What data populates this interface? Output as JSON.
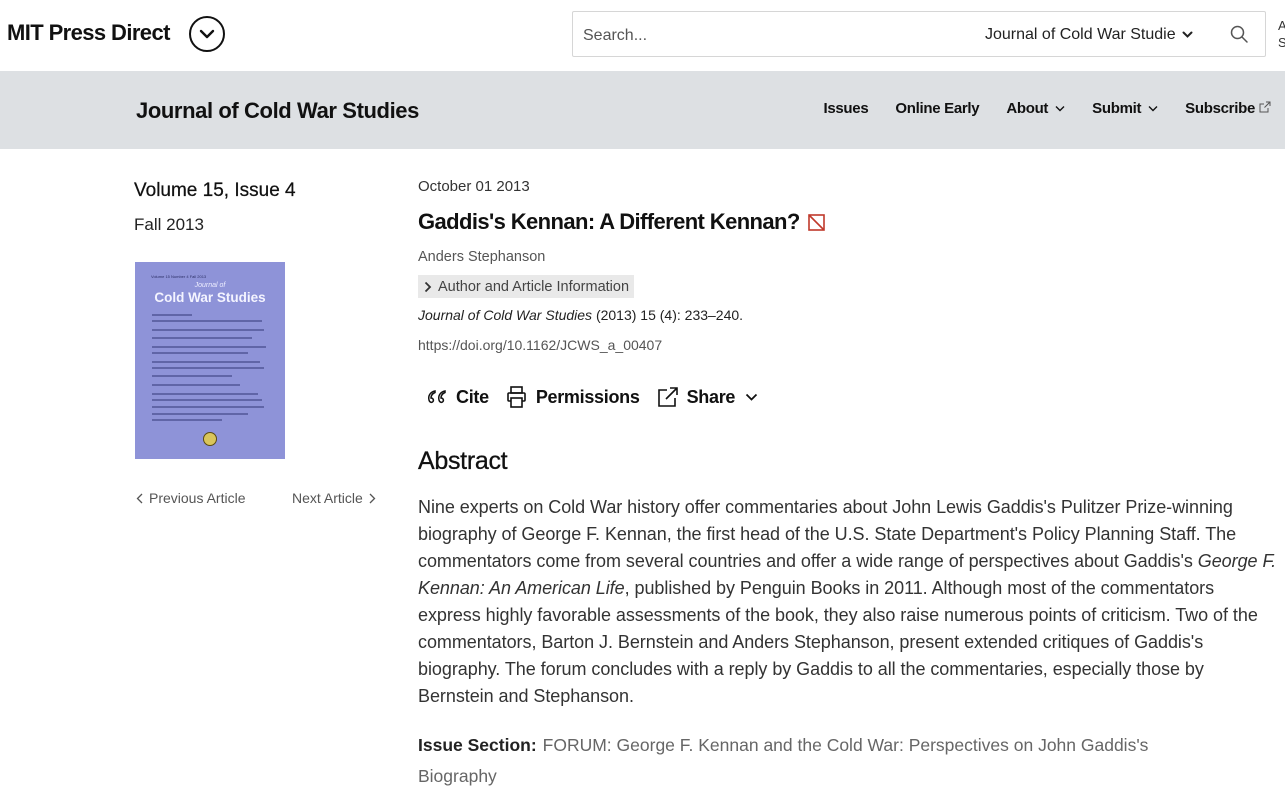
{
  "topbar": {
    "brand": "MIT Press Direct",
    "brand_toggle_icon": "chevron-down-icon",
    "search": {
      "placeholder": "Search...",
      "value": ""
    },
    "scope": "Journal of Cold War Studies",
    "search_icon": "search-icon",
    "edge_text": "A S"
  },
  "journal": {
    "title": "Journal of Cold War Studies",
    "nav": [
      {
        "label": "Issues"
      },
      {
        "label": "Online Early"
      },
      {
        "label": "About",
        "icon": "chevron-down-icon"
      },
      {
        "label": "Submit",
        "icon": "chevron-down-icon"
      },
      {
        "label": "Subscribe",
        "icon": "external-link-icon"
      }
    ]
  },
  "issue": {
    "volume_issue": "Volume 15, Issue 4",
    "season": "Fall 2013",
    "cover": {
      "small_header": "Volume 15  Number 4                                    Fall 2013",
      "journal_of": "Journal of",
      "title": "Cold War Studies"
    },
    "prev_label": "Previous Article",
    "next_label": "Next Article"
  },
  "article": {
    "date": "October 01 2013",
    "title": "Gaddis's Kennan: A Different Kennan?",
    "access_icon": "no-access-icon",
    "author": "Anders Stephanson",
    "info_toggle": "Author and Article Information",
    "citation_journal": "Journal of Cold War Studies",
    "citation_rest": " (2013) 15 (4): 233–240.",
    "doi": "https://doi.org/10.1162/JCWS_a_00407",
    "tools": {
      "cite": "Cite",
      "permissions": "Permissions",
      "share": "Share"
    },
    "abstract_heading": "Abstract",
    "abstract_part1": "Nine experts on Cold War history offer commentaries about John Lewis Gaddis's Pulitzer Prize-winning biography of George F. Kennan, the first head of the U.S. State Department's Policy Planning Staff. The commentators come from several countries and offer a wide range of perspectives about Gaddis's ",
    "abstract_book": "George F. Kennan: An American Life",
    "abstract_part2": ", published by Penguin Books in 2011. Although most of the commentators express highly favorable assessments of the book, they also raise numerous points of criticism. Two of the commentators, Barton J. Bernstein and Anders Stephanson, present extended critiques of Gaddis's biography. The forum concludes with a reply by Gaddis to all the commentaries, especially those by Bernstein and Stephanson.",
    "issue_section_label": "Issue Section:",
    "issue_section_value": "FORUM: George F. Kennan and the Cold War: Perspectives on John Gaddis's Biography"
  }
}
